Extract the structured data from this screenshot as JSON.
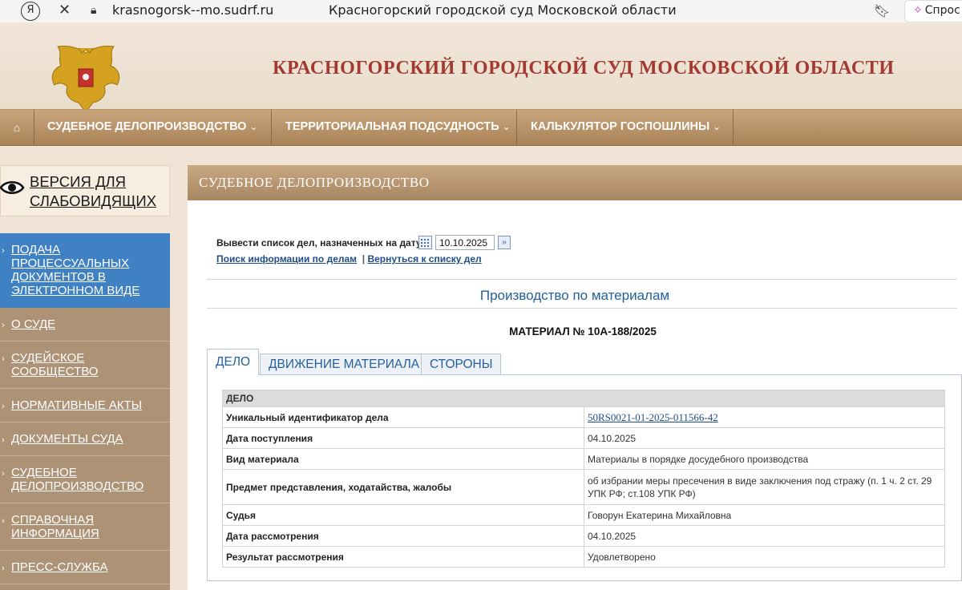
{
  "browser": {
    "url": "krasnogorsk--mo.sudrf.ru",
    "tab_title": "Красногорский городской суд Московской области",
    "ask_label": "Спрос"
  },
  "header": {
    "court_title": "КРАСНОГОРСКИЙ ГОРОДСКОЙ СУД МОСКОВСКОЙ ОБЛАСТИ"
  },
  "nav": {
    "home_icon": "home-icon",
    "items": [
      {
        "label": "СУДЕБНОЕ ДЕЛОПРОИЗВОДСТВО"
      },
      {
        "label": "ТЕРРИТОРИАЛЬНАЯ ПОДСУДНОСТЬ"
      },
      {
        "label": "КАЛЬКУЛЯТОР ГОСПОШЛИНЫ"
      }
    ]
  },
  "sidebar": {
    "vi_label": "ВЕРСИЯ ДЛЯ СЛАБОВИДЯЩИХ",
    "items": [
      {
        "label": "ПОДАЧА ПРОЦЕССУАЛЬНЫХ ДОКУМЕНТОВ В ЭЛЕКТРОННОМ ВИДЕ"
      },
      {
        "label": "О СУДЕ"
      },
      {
        "label": "СУДЕЙСКОЕ СООБЩЕСТВО"
      },
      {
        "label": "НОРМАТИВНЫЕ АКТЫ"
      },
      {
        "label": "ДОКУМЕНТЫ СУДА"
      },
      {
        "label": "СУДЕБНОЕ ДЕЛОПРОИЗВОДСТВО"
      },
      {
        "label": "СПРАВОЧНАЯ ИНФОРМАЦИЯ"
      },
      {
        "label": "ПРЕСС-СЛУЖБА"
      }
    ]
  },
  "main": {
    "section_title": "СУДЕБНОЕ ДЕЛОПРОИЗВОДСТВО",
    "date_prompt": "Вывести список дел, назначенных на дату",
    "date_value": "10.10.2025",
    "link_search": "Поиск информации по делам",
    "link_separator": "|",
    "link_back": "Вернуться к списку дел",
    "proceeding_title": "Производство по материалам",
    "material_title": "МАТЕРИАЛ № 10А-188/2025",
    "tabs": [
      {
        "label": "ДЕЛО"
      },
      {
        "label": "ДВИЖЕНИЕ МАТЕРИАЛА"
      },
      {
        "label": "СТОРОНЫ"
      }
    ],
    "table": {
      "group_header": "ДЕЛО",
      "rows": [
        {
          "key": "Уникальный идентификатор дела",
          "value": "50RS0021-01-2025-011566-42"
        },
        {
          "key": "Дата поступления",
          "value": "04.10.2025"
        },
        {
          "key": "Вид материала",
          "value": "Материалы в порядке досудебного производства"
        },
        {
          "key": "Предмет представления, ходатайства, жалобы",
          "value": "об избрании меры пресечения в виде заключения под стражу (п. 1 ч. 2 ст. 29 УПК РФ; ст.108 УПК РФ)"
        },
        {
          "key": "Судья",
          "value": "Говорун Екатерина Михайловна"
        },
        {
          "key": "Дата рассмотрения",
          "value": "04.10.2025"
        },
        {
          "key": "Результат рассмотрения",
          "value": "Удовлетворено"
        }
      ]
    }
  },
  "colors": {
    "title_red": "#a23a33",
    "nav_brown": "#a98358",
    "sidebar_brown": "#ad9275",
    "active_blue": "#3f81c3",
    "link_blue": "#1f4e8a"
  }
}
